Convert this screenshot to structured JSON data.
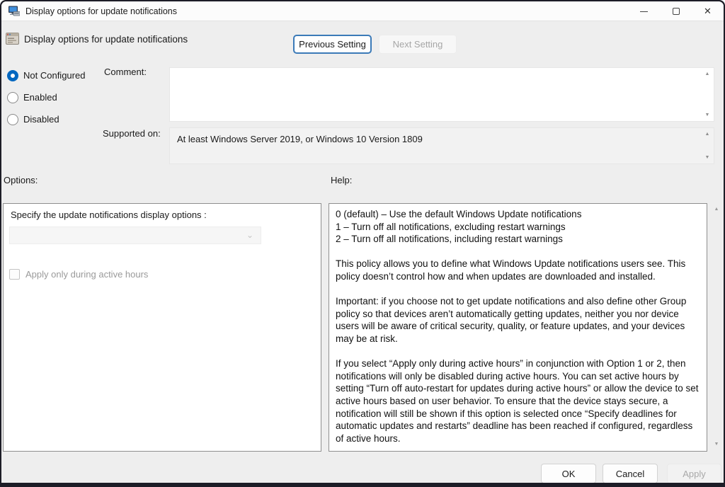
{
  "window": {
    "title": "Display options for update notifications"
  },
  "icons": {
    "minimize": "─",
    "close": "✕",
    "scroll_up": "▲",
    "scroll_down": "▼",
    "dropdown_chevron": "⌄"
  },
  "header": {
    "policy_title": "Display options for update notifications",
    "previous_button": "Previous Setting",
    "next_button": "Next Setting"
  },
  "state": {
    "selected": "Not Configured",
    "radios": [
      {
        "label": "Not Configured",
        "selected": true
      },
      {
        "label": "Enabled",
        "selected": false
      },
      {
        "label": "Disabled",
        "selected": false
      }
    ]
  },
  "comment": {
    "label": "Comment:",
    "value": ""
  },
  "supported_on": {
    "label": "Supported on:",
    "value": "At least Windows Server 2019, or Windows 10 Version 1809"
  },
  "options": {
    "section_label": "Options:",
    "dropdown_label": "Specify the update notifications display options :",
    "dropdown_value": "",
    "checkbox_label": "Apply only during active hours",
    "checkbox_checked": false
  },
  "help": {
    "section_label": "Help:",
    "option_lines": [
      "0 (default) – Use the default Windows Update notifications",
      "1 – Turn off all notifications, excluding restart warnings",
      "2 – Turn off all notifications, including restart warnings"
    ],
    "paragraphs": [
      "This policy allows you to define what Windows Update notifications users see. This policy doesn’t control how and when updates are downloaded and installed.",
      "Important: if you choose not to get update notifications and also define other Group policy so that devices aren’t automatically getting updates, neither you nor device users will be aware of critical security, quality, or feature updates, and your devices may be at risk.",
      "If you select “Apply only during active hours” in conjunction with Option 1 or 2, then notifications will only be disabled during active hours. You can set active hours by setting “Turn off auto-restart for updates during active hours” or allow the device to set active hours based on user behavior. To ensure that the device stays secure, a notification will still be shown if this option is selected once “Specify deadlines for automatic updates and restarts” deadline has been reached if configured, regardless of active hours."
    ]
  },
  "footer": {
    "ok_label": "OK",
    "cancel_label": "Cancel",
    "apply_label": "Apply"
  },
  "colors": {
    "accent": "#0067c0",
    "titlebar_bg": "#fcfcfc",
    "body_bg": "#eeeeee",
    "panel_border": "#8f8f8f",
    "disabled_text": "#a6a6a6",
    "frame": "#1d1d27"
  }
}
